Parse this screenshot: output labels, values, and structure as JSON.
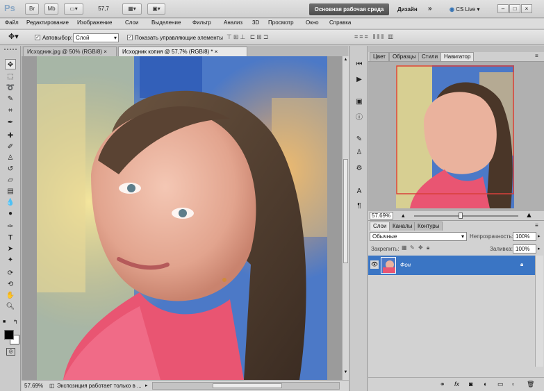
{
  "titlebar": {
    "logo": "Ps",
    "br_label": "Br",
    "mb_label": "Mb",
    "zoom": "57,7",
    "workspace": "Основная рабочая среда",
    "design": "Дизайн",
    "more": "»",
    "cslive": "CS Live"
  },
  "menu": [
    "Файл",
    "Редактирование",
    "Изображение",
    "Слои",
    "Выделение",
    "Фильтр",
    "Анализ",
    "3D",
    "Просмотр",
    "Окно",
    "Справка"
  ],
  "options": {
    "autoselect_label": "Автовыбор:",
    "autoselect_value": "Слой",
    "show_controls_label": "Показать управляющие элементы"
  },
  "documents": {
    "tabs": [
      {
        "label": "Исходник.jpg @ 50% (RGB/8)",
        "active": false
      },
      {
        "label": "Исходник копия @ 57,7% (RGB/8) *",
        "active": true
      }
    ],
    "status_zoom": "57.69%",
    "status_text": "Экспозиция работает только в ..."
  },
  "navigator": {
    "tabs": [
      "Цвет",
      "Образцы",
      "Стили",
      "Навигатор"
    ],
    "zoom": "57.69%"
  },
  "layers": {
    "tabs": [
      "Слои",
      "Каналы",
      "Контуры"
    ],
    "blend_mode": "Обычные",
    "opacity_label": "Непрозрачность:",
    "opacity_value": "100%",
    "lock_label": "Закрепить:",
    "fill_label": "Заливка:",
    "fill_value": "100%",
    "items": [
      {
        "name": "Фон",
        "selected": true
      }
    ]
  }
}
